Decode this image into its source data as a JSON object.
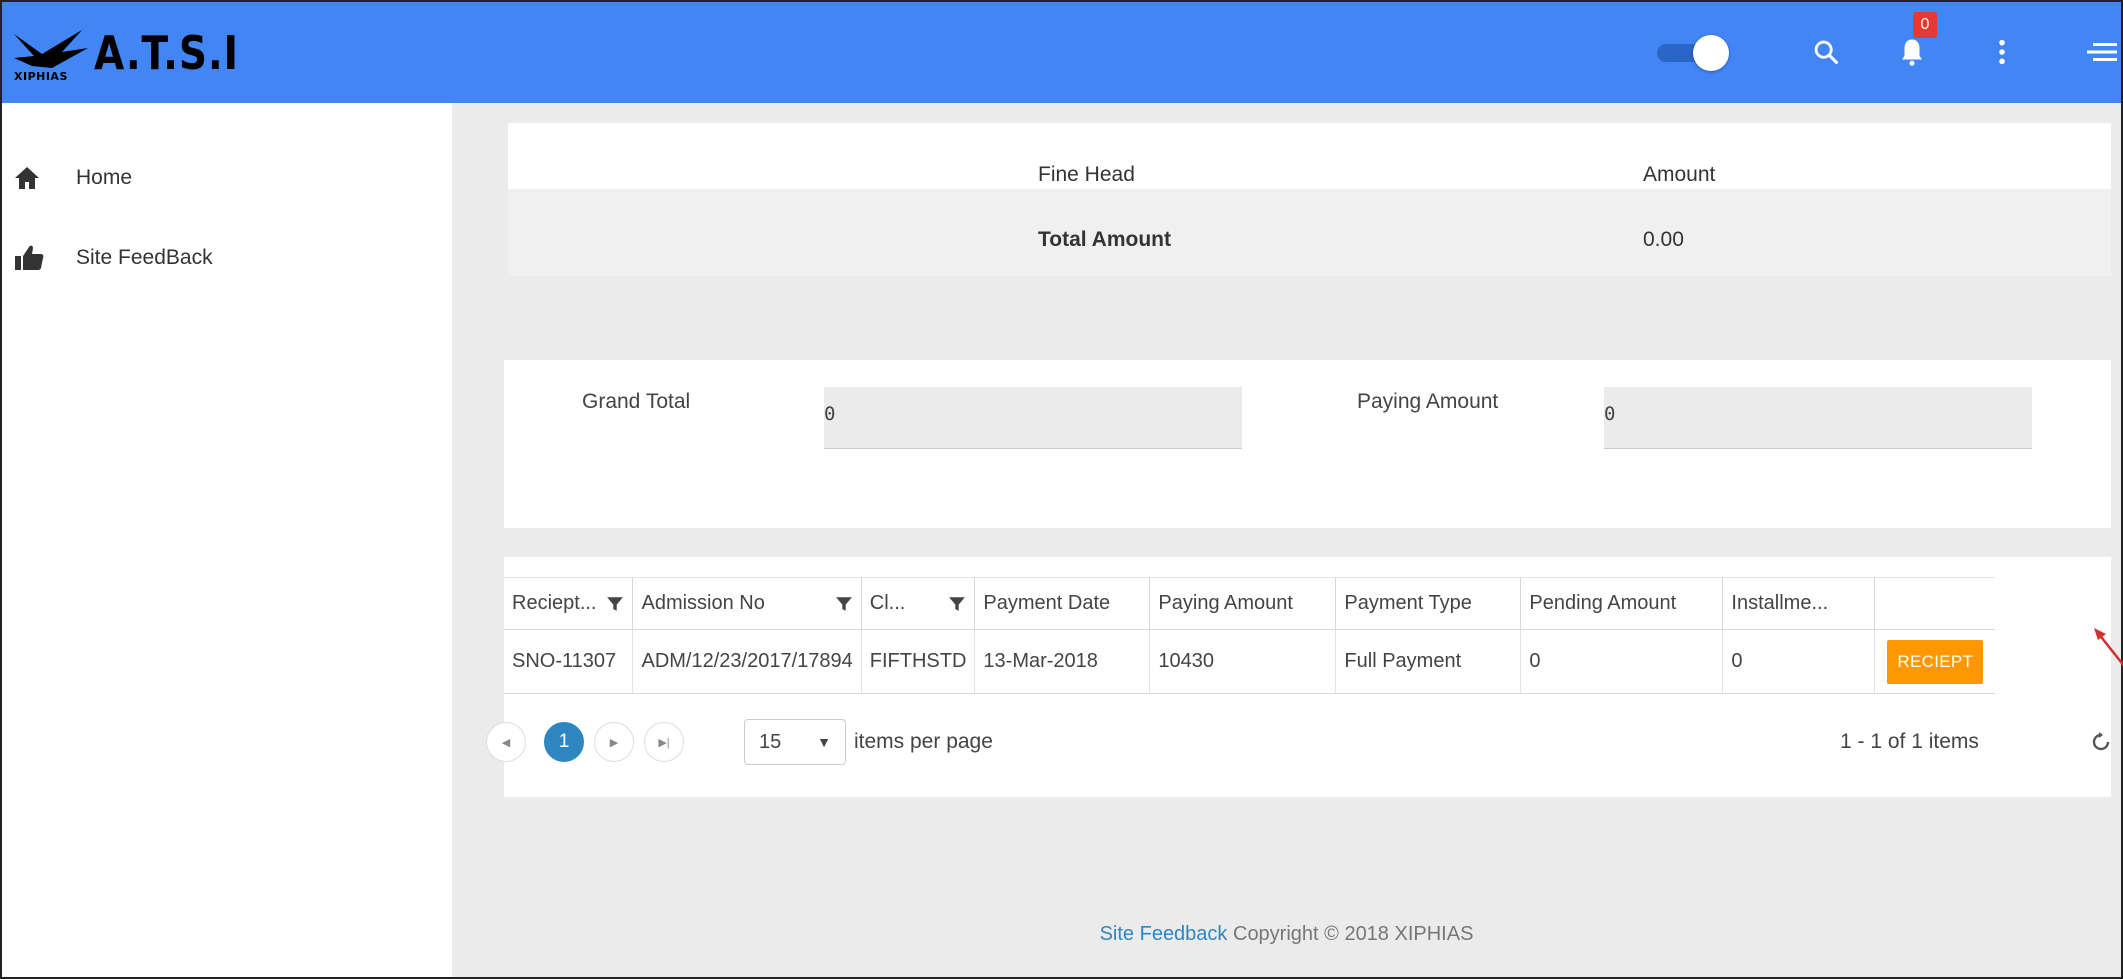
{
  "header": {
    "logo_text": "A.T.S.I",
    "logo_sub": "XIPHIAS",
    "notification_count": "0",
    "accent_color": "#4285f4",
    "icons": [
      "toggle-switch",
      "search-icon",
      "bell-icon",
      "more-vertical-icon",
      "menu-icon"
    ]
  },
  "sidebar": {
    "items": [
      {
        "label": "Home",
        "icon": "home-icon"
      },
      {
        "label": "Site FeedBack",
        "icon": "thumbs-up-icon"
      }
    ]
  },
  "fine_table": {
    "col_fine_head": "Fine Head",
    "col_amount": "Amount",
    "total_label": "Total Amount",
    "total_value": "0.00"
  },
  "totals": {
    "grand_total_label": "Grand Total",
    "grand_total_value": "0",
    "paying_amount_label": "Paying Amount",
    "paying_amount_value": "0"
  },
  "grid": {
    "columns": [
      "Reciept...",
      "Admission No",
      "Cl...",
      "Payment Date",
      "Paying Amount",
      "Payment Type",
      "Pending Amount",
      "Installme..."
    ],
    "rows": [
      {
        "receipt": "SNO-11307",
        "admission_no": "ADM/12/23/2017/17894",
        "class": "FIFTHSTD",
        "payment_date": "13-Mar-2018",
        "paying_amount": "10430",
        "payment_type": "Full Payment",
        "pending_amount": "0",
        "installment": "0",
        "action_label": "RECIEPT"
      }
    ],
    "pager": {
      "current_page": "1",
      "page_size": "15",
      "items_per_page_label": "items per page",
      "info": "1 - 1 of 1 items"
    }
  },
  "footer": {
    "link": "Site Feedback",
    "text": " Copyright © 2018 XIPHIAS"
  },
  "colors": {
    "receipt_button": "#ff9800",
    "pager_active": "#2e86c1",
    "badge": "#e53935"
  }
}
